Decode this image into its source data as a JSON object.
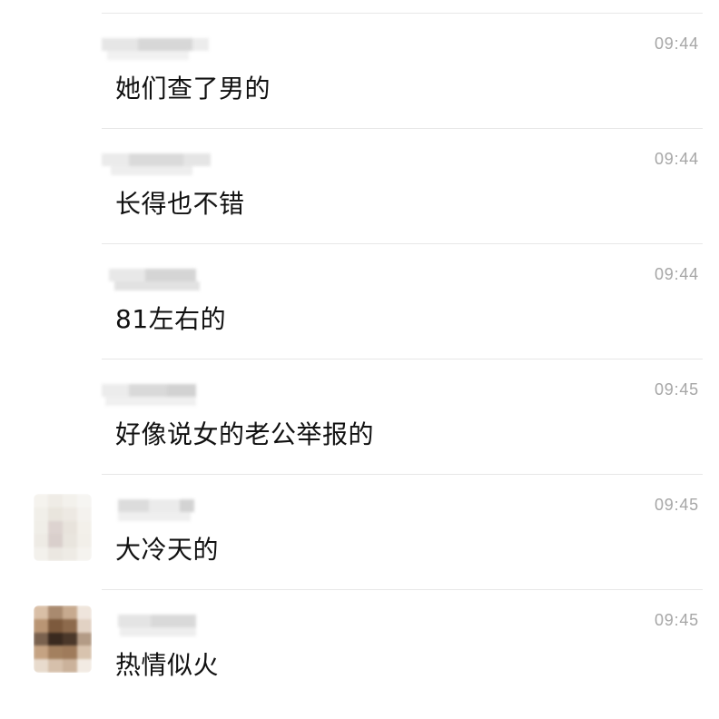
{
  "messages": [
    {
      "time": "09:44",
      "text": "她们查了男的"
    },
    {
      "time": "09:44",
      "text": "长得也不错"
    },
    {
      "time": "09:44",
      "text": "81左右的"
    },
    {
      "time": "09:45",
      "text": "好像说女的老公举报的"
    },
    {
      "time": "09:45",
      "text": "大冷天的"
    },
    {
      "time": "09:45",
      "text": "热情似火"
    }
  ],
  "colors": {
    "background": "#ffffff",
    "divider": "#e7e7e7",
    "time_text": "#a6a6a6",
    "message_text": "#111111"
  }
}
